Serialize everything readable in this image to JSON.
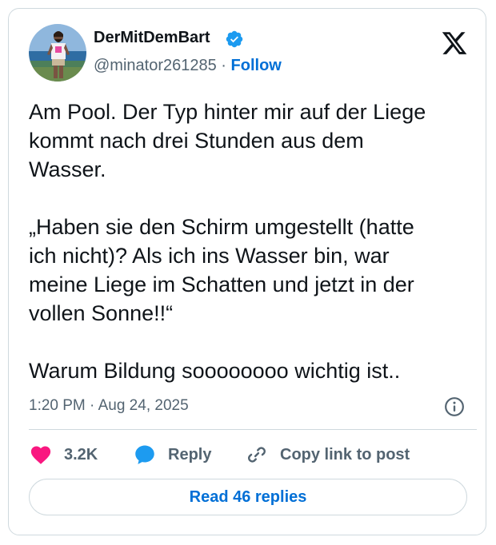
{
  "author": {
    "display_name": "DerMitDemBart",
    "verified": true,
    "handle": "@minator261285",
    "separator": "·",
    "follow_label": "Follow"
  },
  "brand": {
    "logo": "x-logo-icon"
  },
  "tweet": {
    "lines": [
      "Am Pool. Der Typ hinter mir auf der Liege",
      "kommt nach drei Stunden aus dem",
      "Wasser.",
      "",
      "„Haben sie den Schirm umgestellt (hatte",
      "ich nicht)? Als ich ins Wasser bin, war",
      "meine Liege im Schatten und jetzt in der",
      "vollen Sonne!!“",
      "",
      "Warum Bildung soooooooo wichtig ist.."
    ],
    "timestamp": "1:20 PM · Aug 24, 2025"
  },
  "actions": {
    "like_count": "3.2K",
    "reply_label": "Reply",
    "copy_label": "Copy link to post"
  },
  "footer": {
    "read_replies_label": "Read 46 replies"
  },
  "colors": {
    "text_primary": "#0f1419",
    "text_secondary": "#536471",
    "accent_blue": "#006fd6",
    "verified_blue": "#1d9bf0",
    "like_pink": "#f91880",
    "border": "#cfd9de"
  }
}
